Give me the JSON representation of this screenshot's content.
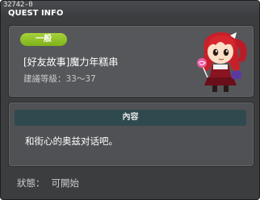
{
  "window": {
    "quest_id": "32742-0",
    "title": "QUEST INFO"
  },
  "quest": {
    "category": "一般",
    "title": "[好友故事]魔力年糕串",
    "level_range": "建議等級：33～37",
    "npc_icon": "red-hair-girl-npc"
  },
  "content": {
    "header": "內容",
    "text": "和街心的奥兹对话吧。"
  },
  "status": {
    "label": "狀態：",
    "value": "可開始"
  },
  "colors": {
    "badge": "#8fc028",
    "content_header": "#2f4a4e",
    "window": "#3c3d3f"
  }
}
